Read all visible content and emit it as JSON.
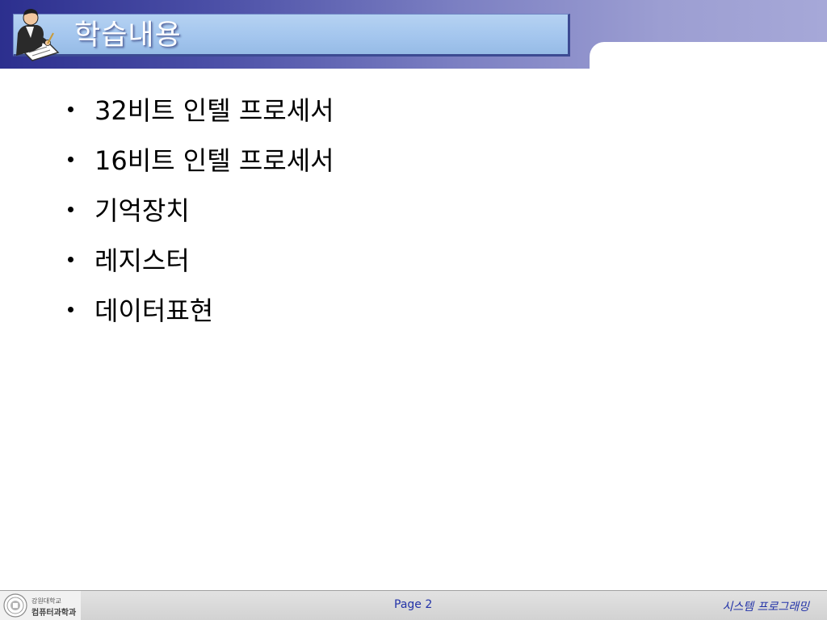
{
  "header": {
    "title": "학습내용",
    "icon": "writer-at-desk-icon"
  },
  "bullets": [
    "32비트 인텔 프로세서",
    "16비트 인텔 프로세서",
    "기억장치",
    "레지스터",
    "데이터표현"
  ],
  "footer": {
    "logo": {
      "icon": "university-seal-icon",
      "line1": "강원대학교",
      "line2": "컴퓨터과학과"
    },
    "page_label": "Page 2",
    "course": "시스템  프로그래밍"
  },
  "colors": {
    "header_dark": "#2c2f8e",
    "header_light": "#a6a8d8",
    "title_box": "#a4c6ee",
    "footer_text": "#2333a8"
  }
}
